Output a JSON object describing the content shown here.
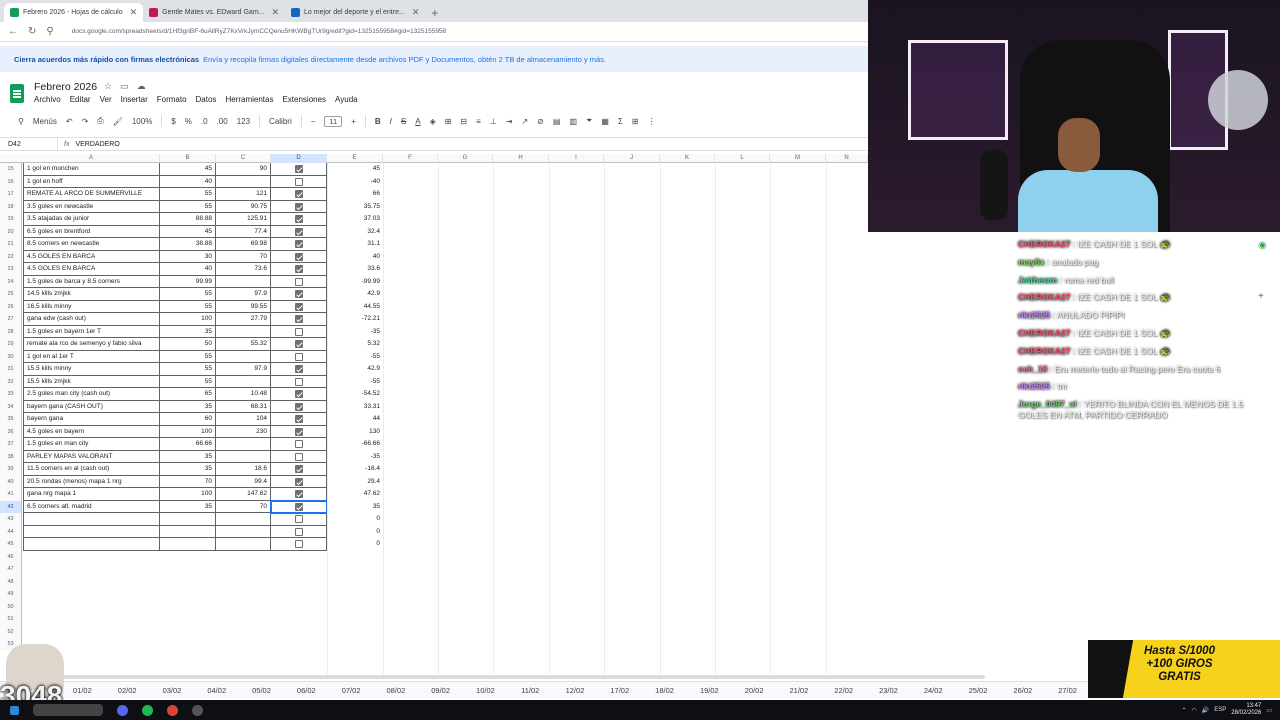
{
  "browser": {
    "tabs": [
      {
        "label": "Febrero 2026 - Hojas de cálculo",
        "active": true,
        "color": "#0f9d58"
      },
      {
        "label": "Gentle Mates vs. EDward Gam...",
        "active": false,
        "color": "#c2185b"
      },
      {
        "label": "Lo mejor del deporte y el entre...",
        "active": false,
        "color": "#1565c0"
      }
    ],
    "url": "docs.google.com/spreadsheets/d/1Hf3griBF-6uAllRyZ7KxVrkJymCCQenu5HKWBgTUr9g/edit?gid=1325155958#gid=1325155958"
  },
  "promo": {
    "bold": "Cierra acuerdos más rápido con firmas electrónicas",
    "text": "Envía y recopila firmas digitales directamente desde archivos PDF y Documentos, obtén 2 TB de almacenamiento y más."
  },
  "sheets": {
    "title": "Febrero 2026",
    "menu": [
      "Archivo",
      "Editar",
      "Ver",
      "Insertar",
      "Formato",
      "Datos",
      "Herramientas",
      "Extensiones",
      "Ayuda"
    ],
    "toolbar": {
      "menus": "Menús",
      "zoom": "100%",
      "currency": "$",
      "percent": "%",
      "num": "123",
      "font": "Calibri",
      "font_size": "11"
    },
    "namebox": "D42",
    "fx": "fx",
    "formula": "VERDADERO",
    "columns": [
      "A",
      "B",
      "C",
      "D",
      "E",
      "F",
      "G",
      "H",
      "I",
      "J",
      "K",
      "L",
      "M",
      "N"
    ],
    "rows": [
      {
        "n": "15",
        "a": "1 gol en monchen",
        "b": "45",
        "c": "90",
        "d": true,
        "e": "45"
      },
      {
        "n": "16",
        "a": "1 gol en hoff",
        "b": "40",
        "c": "",
        "d": false,
        "e": "-40"
      },
      {
        "n": "17",
        "a": "REMATE AL ARCO DE SUMMERVILLE",
        "b": "55",
        "c": "121",
        "d": true,
        "e": "66"
      },
      {
        "n": "18",
        "a": "3.5 goles en newcastle",
        "b": "55",
        "c": "90.75",
        "d": true,
        "e": "35.75"
      },
      {
        "n": "19",
        "a": "3.5 atajadas de junior",
        "b": "88.88",
        "c": "125.91",
        "d": true,
        "e": "37.03"
      },
      {
        "n": "20",
        "a": "6.5 goles en brentford",
        "b": "45",
        "c": "77.4",
        "d": true,
        "e": "32.4"
      },
      {
        "n": "21",
        "a": "8.5 corners en newcastle",
        "b": "38.88",
        "c": "69.98",
        "d": true,
        "e": "31.1"
      },
      {
        "n": "22",
        "a": "4.5 GOLES EN BARCA",
        "b": "30",
        "c": "70",
        "d": true,
        "e": "40"
      },
      {
        "n": "23",
        "a": "4.5 GOLES EN BARCA",
        "b": "40",
        "c": "73.6",
        "d": true,
        "e": "33.6"
      },
      {
        "n": "24",
        "a": "1.5 goles de barca y 8.5 corners",
        "b": "99.99",
        "c": "",
        "d": false,
        "e": "-99.99"
      },
      {
        "n": "25",
        "a": "14.5 kills zmjkk",
        "b": "55",
        "c": "97.9",
        "d": true,
        "e": "42.9"
      },
      {
        "n": "26",
        "a": "16.5 kills minny",
        "b": "55",
        "c": "99.55",
        "d": true,
        "e": "44.55"
      },
      {
        "n": "27",
        "a": "gana edw (cash out)",
        "b": "100",
        "c": "27.79",
        "d": true,
        "e": "-72.21"
      },
      {
        "n": "28",
        "a": "1.5 goles en bayern 1er T",
        "b": "35",
        "c": "",
        "d": false,
        "e": "-35"
      },
      {
        "n": "29",
        "a": "remate ala rco de semenyo y fabio silva",
        "b": "50",
        "c": "55.32",
        "d": true,
        "e": "5.32"
      },
      {
        "n": "30",
        "a": "1 gol en al 1er T",
        "b": "55",
        "c": "",
        "d": false,
        "e": "-55"
      },
      {
        "n": "31",
        "a": "15.5 kills minny",
        "b": "55",
        "c": "97.9",
        "d": true,
        "e": "42.9"
      },
      {
        "n": "32",
        "a": "15.5 kills zmjkk",
        "b": "55",
        "c": "",
        "d": false,
        "e": "-55"
      },
      {
        "n": "33",
        "a": "2.5 goles man city (cash out)",
        "b": "65",
        "c": "10.48",
        "d": true,
        "e": "-54.52"
      },
      {
        "n": "34",
        "a": "bayern gana (CASH OUT)",
        "b": "35",
        "c": "68.31",
        "d": true,
        "e": "33.31"
      },
      {
        "n": "35",
        "a": "bayern gana",
        "b": "60",
        "c": "104",
        "d": true,
        "e": "44"
      },
      {
        "n": "36",
        "a": "4.5 goles en bayern",
        "b": "100",
        "c": "230",
        "d": true,
        "e": "130"
      },
      {
        "n": "37",
        "a": "1.5 goles en man city",
        "b": "66.66",
        "c": "",
        "d": false,
        "e": "-66.66"
      },
      {
        "n": "38",
        "a": "PARLEY MAPAS VALORANT",
        "b": "35",
        "c": "",
        "d": false,
        "e": "-35"
      },
      {
        "n": "39",
        "a": "11.5 corners en al (cash out)",
        "b": "35",
        "c": "18.6",
        "d": true,
        "e": "-16.4"
      },
      {
        "n": "40",
        "a": "20.5 rondas (menos) mapa 1 nrg",
        "b": "70",
        "c": "99.4",
        "d": true,
        "e": "29.4"
      },
      {
        "n": "41",
        "a": "gana nrg mapa 1",
        "b": "100",
        "c": "147.62",
        "d": true,
        "e": "47.62"
      },
      {
        "n": "42",
        "a": "6.5 corners atl. madrid",
        "b": "35",
        "c": "70",
        "d": true,
        "e": "35"
      },
      {
        "n": "43",
        "a": "",
        "b": "",
        "c": "",
        "d": false,
        "e": "0"
      },
      {
        "n": "44",
        "a": "",
        "b": "",
        "c": "",
        "d": false,
        "e": "0"
      },
      {
        "n": "45",
        "a": "",
        "b": "",
        "c": "",
        "d": false,
        "e": "0"
      },
      {
        "n": "46",
        "a": "",
        "b": "",
        "c": "",
        "d": null,
        "e": ""
      },
      {
        "n": "47",
        "a": "",
        "b": "",
        "c": "",
        "d": null,
        "e": ""
      },
      {
        "n": "48",
        "a": "",
        "b": "",
        "c": "",
        "d": null,
        "e": ""
      },
      {
        "n": "49",
        "a": "",
        "b": "",
        "c": "",
        "d": null,
        "e": ""
      },
      {
        "n": "50",
        "a": "",
        "b": "",
        "c": "",
        "d": null,
        "e": ""
      },
      {
        "n": "51",
        "a": "",
        "b": "",
        "c": "",
        "d": null,
        "e": ""
      },
      {
        "n": "52",
        "a": "",
        "b": "",
        "c": "",
        "d": null,
        "e": ""
      },
      {
        "n": "53",
        "a": "",
        "b": "",
        "c": "",
        "d": null,
        "e": ""
      }
    ],
    "sheet_tabs": [
      "01/02",
      "02/02",
      "03/02",
      "04/02",
      "05/02",
      "06/02",
      "07/02",
      "08/02",
      "09/02",
      "10/02",
      "11/02",
      "12/02",
      "17/02",
      "18/02",
      "19/02",
      "20/02",
      "21/02",
      "22/02",
      "23/02",
      "24/02",
      "25/02",
      "26/02",
      "27/02"
    ]
  },
  "chat": [
    {
      "user": "CHEROKA27",
      "color": "#ff4b6e",
      "msg": "IZE CASH DE 1 SOL",
      "emote": "🐢"
    },
    {
      "user": "may8x",
      "color": "#7ad957",
      "msg": "anulado pag"
    },
    {
      "user": "Jetthewm",
      "color": "#3ddc97",
      "msg": "roma red bull"
    },
    {
      "user": "CHEROKA27",
      "color": "#ff4b6e",
      "msg": "IZE CASH DE 1 SOL",
      "emote": "🐢"
    },
    {
      "user": "rikt2525",
      "color": "#c080ff",
      "msg": "ANULADO PIPIPI"
    },
    {
      "user": "CHEROKA27",
      "color": "#ff4b6e",
      "msg": "IZE CASH DE 1 SOL",
      "emote": "🐢"
    },
    {
      "user": "CHEROKA27",
      "color": "#ff4b6e",
      "msg": "IZE CASH DE 1 SOL",
      "emote": "🐢"
    },
    {
      "user": "osh_18",
      "color": "#e07090",
      "msg": "Era meterle todo al Racing pero Era cuota 6"
    },
    {
      "user": "rikt2525",
      "color": "#c080ff",
      "msg": "tnr"
    },
    {
      "user": "Jorge_0497_vl",
      "color": "#6cd06c",
      "msg": "YERITO BLINDA CON EL MENOS DE 1.5 GOLES EN ATM, PARTIDO CERRADO"
    }
  ],
  "ad": {
    "line1": "Hasta S/1000",
    "line2": "+100 GIROS",
    "line3": "GRATIS"
  },
  "overlay": {
    "count": "3048"
  },
  "clock": {
    "time": "13:47",
    "date": "28/02/2026",
    "lang": "ESP"
  }
}
